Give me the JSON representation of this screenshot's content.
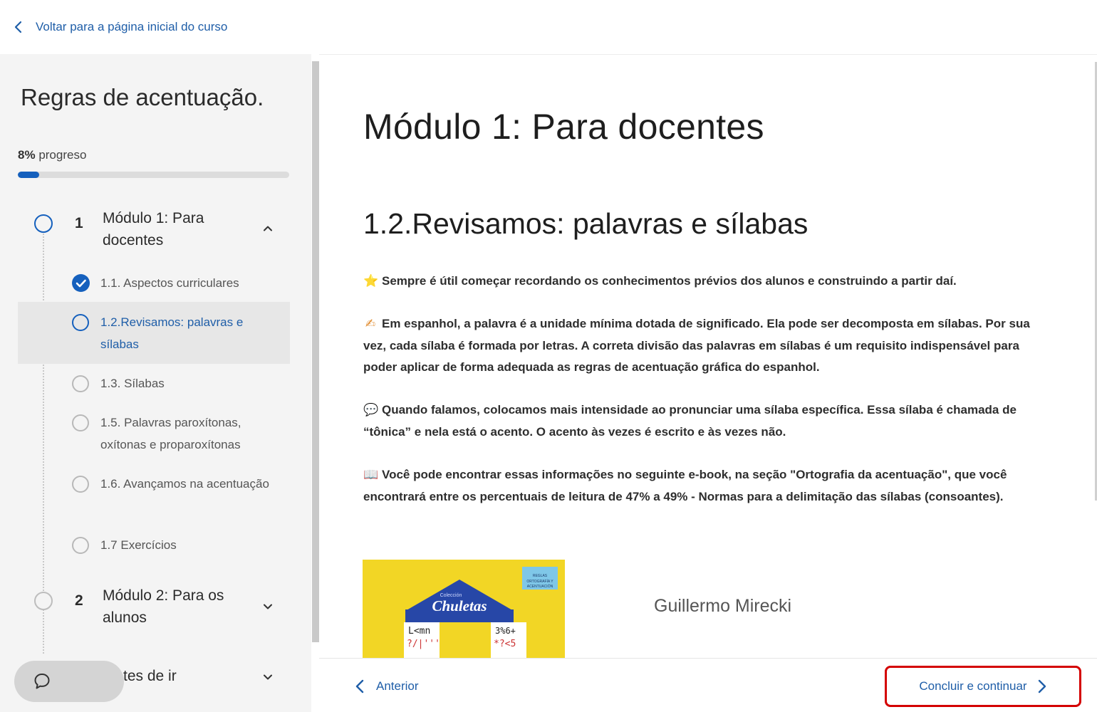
{
  "topbar": {
    "back_label": "Voltar para a página inicial do curso"
  },
  "sidebar": {
    "course_title": "Regras de acentuação.",
    "progress_percent": "8%",
    "progress_text": "progreso",
    "progress_value": 0.08,
    "modules": [
      {
        "number": "1",
        "title": "Módulo 1: Para docentes",
        "expanded": true
      },
      {
        "number": "2",
        "title": "Módulo 2: Para os alunos",
        "expanded": false
      },
      {
        "number": "",
        "title": "tes de ir",
        "expanded": false
      }
    ],
    "lessons": [
      {
        "label": "1.1. Aspectos curriculares",
        "state": "completed"
      },
      {
        "label": "1.2.Revisamos: palavras e sílabas",
        "state": "active"
      },
      {
        "label": "1.3. Sílabas",
        "state": "pending"
      },
      {
        "label": "1.5. Palavras paroxítonas, oxítonas e proparoxítonas",
        "state": "pending"
      },
      {
        "label": "1.6. Avançamos na acentuação",
        "state": "pending"
      },
      {
        "label": "1.7 Exercícios",
        "state": "pending"
      }
    ]
  },
  "main": {
    "module_title": "Módulo 1: Para docentes",
    "lesson_title": "1.2.Revisamos: palavras e sílabas",
    "paragraphs": [
      {
        "emoji": "⭐",
        "text": "Sempre é útil começar recordando os conhecimentos prévios dos alunos e construindo a partir daí."
      },
      {
        "emoji": "✍",
        "text": "Em espanhol, a palavra é a unidade mínima dotada de significado. Ela pode ser decomposta em sílabas. Por sua vez, cada sílaba é formada por letras. A correta divisão das palavras em sílabas é um requisito indispensável para poder aplicar de forma adequada as regras de acentuação gráfica do espanhol."
      },
      {
        "emoji": "💬",
        "text": "Quando falamos, colocamos mais intensidade ao pronunciar uma sílaba específica. Essa sílaba é chamada de “tônica” e nela está o acento. O acento às vezes é escrito e às vezes não."
      },
      {
        "emoji": "📖",
        "text": "Você pode encontrar essas informações no seguinte e-book, na seção \"Ortografia da acentuação\", que você encontrará entre os percentuais de leitura de 47% a 49% - Normas para a delimitação das sílabas (consoantes)."
      }
    ],
    "book": {
      "collection": "Colección",
      "title": "Chuletas",
      "badge": "REGLAS ORTOGRAFÍA Y ACENTUACIÓN",
      "author": "Guillermo Mirecki"
    }
  },
  "footer": {
    "prev_label": "Anterior",
    "next_label": "Concluir e continuar"
  },
  "colors": {
    "accent": "#1560bd",
    "link": "#1f5ea8",
    "highlight": "#d40000"
  }
}
